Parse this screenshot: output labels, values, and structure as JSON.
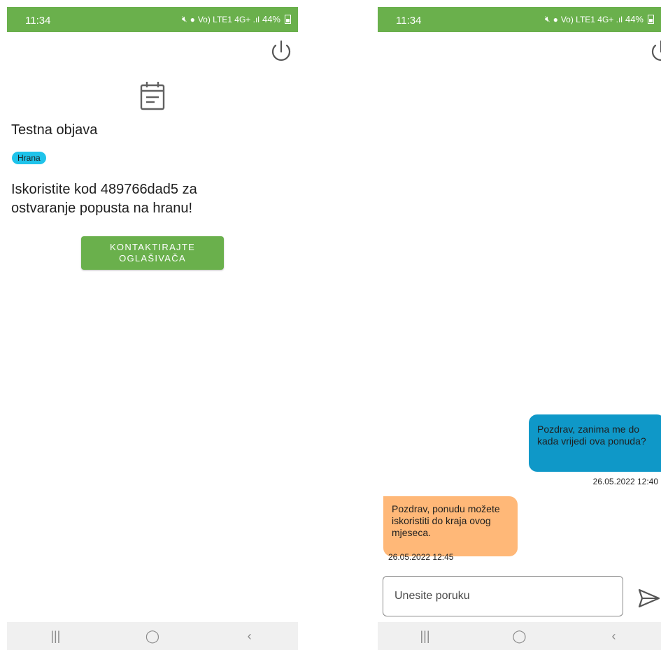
{
  "left_screen": {
    "status": {
      "time": "11:34",
      "indicators": "Vo) LTE1 4G+ .ıl",
      "battery": "44%"
    },
    "post": {
      "icon": "document-icon",
      "title": "Testna objava",
      "category": "Hrana",
      "body": "Iskoristite kod 489766dad5 za ostvaranje popusta na hranu!",
      "contact_button": "KONTAKTIRAJTE\nOGLAŠIVAČA"
    }
  },
  "right_screen": {
    "status": {
      "time": "11:34",
      "indicators": "Vo) LTE1 4G+ .ıl",
      "battery": "44%"
    },
    "messages": [
      {
        "direction": "outgoing",
        "text": "Pozdrav, zanima me do kada vrijedi ova ponuda?",
        "time": "26.05.2022 12:40",
        "color": "#0f98c8"
      },
      {
        "direction": "incoming",
        "text": "Pozdrav, ponudu možete iskoristiti do kraja ovog mjeseca.",
        "time": "26.05.2022 12:45",
        "color": "#ffb878"
      }
    ],
    "input": {
      "placeholder": "Unesite poruku",
      "value": ""
    }
  },
  "nav": {
    "recents": "|||",
    "home": "◯",
    "back": "‹"
  },
  "colors": {
    "accent": "#6ab04c",
    "chip": "#1fc3ea"
  }
}
